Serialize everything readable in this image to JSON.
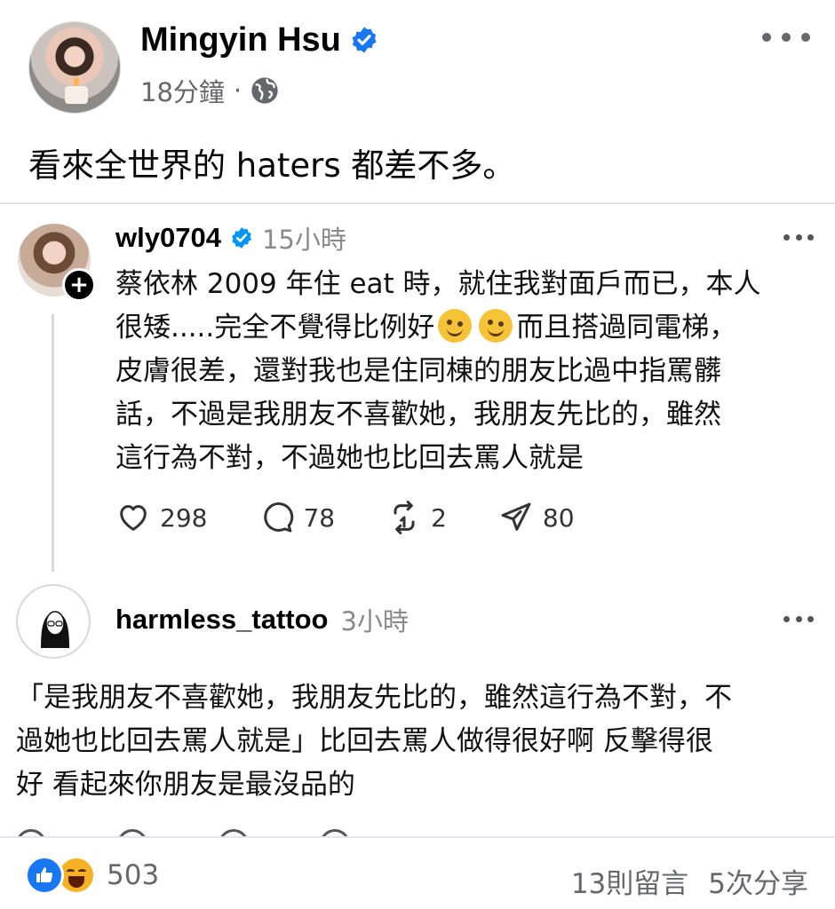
{
  "post": {
    "author": "Mingyin Hsu",
    "time": "18分鐘",
    "separator": "·",
    "caption": "看來全世界的 haters 都差不多。"
  },
  "threads": {
    "reply1": {
      "username": "wly0704",
      "time": "15小時",
      "lines": [
        "蔡依林 2009 年住 eat 時，就住我對面戶而已，本人",
        "很矮.....完全不覺得比例好",
        "而且搭過同電梯，",
        "皮膚很差，還對我也是住同棟的朋友比過中指罵髒",
        "話，不過是我朋友不喜歡她，我朋友先比的，雖然",
        "這行為不對，不過她也比回去罵人就是"
      ],
      "likes": "298",
      "comments": "78",
      "reposts": "2",
      "shares": "80"
    },
    "reply2": {
      "username": "harmless_tattoo",
      "time": "3小時",
      "lines": [
        "「是我朋友不喜歡她，我朋友先比的，雖然這行為不對，不",
        "過她也比回去罵人就是」比回去罵人做得很好啊 反擊得很",
        "好 看起來你朋友是最沒品的"
      ]
    }
  },
  "footer": {
    "reaction_count": "503",
    "comments": "13則留言",
    "shares": "5次分享"
  },
  "colors": {
    "facebook_blue": "#1877f2",
    "threads_verified": "#0095f6",
    "haha_yellow": "#f7b125"
  }
}
